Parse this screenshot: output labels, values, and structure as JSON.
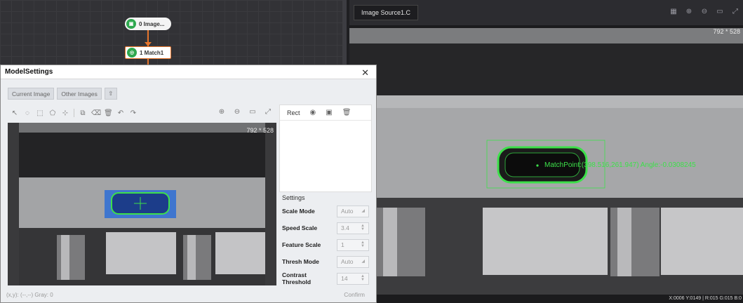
{
  "flow": {
    "nodes": [
      {
        "label": "0 Image...",
        "icon": "image-node-icon"
      },
      {
        "label": "1 Match1",
        "icon": "match-node-icon"
      }
    ],
    "connector_color": "#e8762c"
  },
  "dialog": {
    "title": "ModelSettings",
    "close": "✕",
    "tabs": [
      {
        "label": "Current Image"
      },
      {
        "label": "Other Images"
      },
      {
        "label": "⇧"
      }
    ],
    "resolution": "792 * 528",
    "shape": {
      "label": "Rect"
    },
    "settings_title": "Settings",
    "settings": [
      {
        "label": "Scale Mode",
        "value": "Auto",
        "control": "select"
      },
      {
        "label": "Speed Scale",
        "value": "3.4",
        "control": "spinner"
      },
      {
        "label": "Feature Scale",
        "value": "1",
        "control": "spinner"
      },
      {
        "label": "Thresh Mode",
        "value": "Auto",
        "control": "select"
      },
      {
        "label": "Contrast Threshold",
        "value": "14",
        "control": "spinner"
      }
    ],
    "status": "(x,y): (--,--) Gray: 0",
    "confirm": "Confirm"
  },
  "source": {
    "tab": "Image Source1.C",
    "resolution": "792 * 528",
    "match_text": "MatchPoint:(398.516,261.947) Angle:-0.0308245",
    "status": "X:0006 Y:0149 | R:015 G:015 B:0"
  },
  "colors": {
    "match_green": "#3de04a",
    "roi_blue": "#2e6fd6",
    "accent_orange": "#e8762c"
  }
}
